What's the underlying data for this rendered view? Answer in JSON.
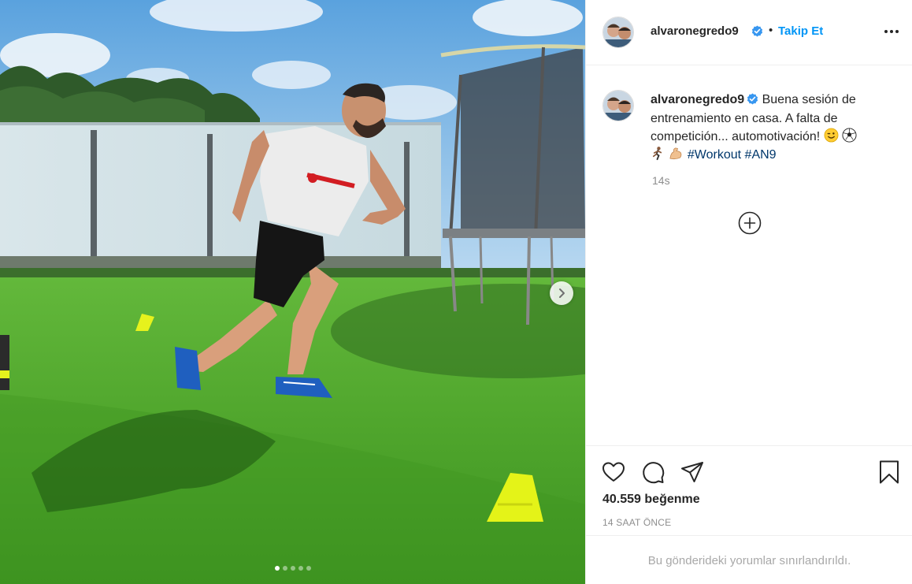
{
  "post": {
    "username": "alvaronegredo9",
    "follow_label": "Takip Et",
    "separator": "•",
    "caption_text": "Buena sesión de entrenamiento en casa. A falta de competición... automotivación! ",
    "emojis": [
      "winking-face",
      "soccer-ball",
      "person-running",
      "flexed-biceps"
    ],
    "hashtags": [
      "#Workout",
      "#AN9"
    ],
    "caption_time": "14s",
    "likes_count": "40.559",
    "likes_label": "beğenme",
    "posted_ago": "14 SAAT ÖNCE",
    "comments_limited": "Bu gönderideki yorumlar sınırlandırıldı."
  },
  "carousel": {
    "slide_count": 5,
    "active_index": 0
  },
  "icons": {
    "more": "more-options-icon",
    "like": "heart-icon",
    "comment": "comment-icon",
    "share": "send-icon",
    "save": "bookmark-icon",
    "load_more": "plus-circle-icon",
    "next": "chevron-right-icon",
    "verified": "verified-badge-icon"
  },
  "colors": {
    "link_blue": "#0095f6",
    "hashtag": "#00376b",
    "verified": "#3897f0",
    "muted": "#8e8e8e",
    "border": "#efefef"
  }
}
